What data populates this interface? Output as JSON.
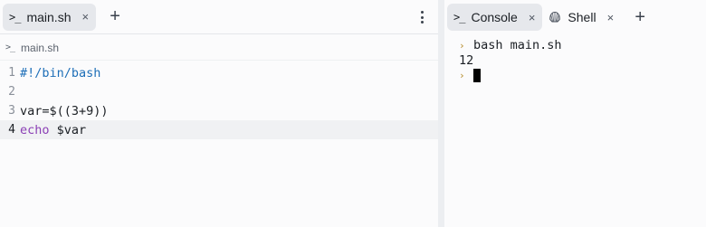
{
  "editor_pane": {
    "tab": {
      "icon": "terminal-prompt-icon",
      "label": "main.sh",
      "close": "×"
    },
    "new_tab": "+",
    "menu_icon": "kebab-menu-icon",
    "breadcrumb": {
      "icon": "terminal-prompt-icon",
      "label": "main.sh"
    },
    "lines": [
      {
        "number": "1",
        "text": "#!/bin/bash"
      },
      {
        "number": "2",
        "text": ""
      },
      {
        "number": "3",
        "text": "var=$((3+9))"
      },
      {
        "number": "4",
        "keyword": "echo",
        "text": " $var"
      }
    ]
  },
  "console_pane": {
    "tabs": [
      {
        "icon": "terminal-prompt-icon",
        "label": "Console",
        "close": "×",
        "active": true
      },
      {
        "icon": "shell-icon",
        "label": "Shell",
        "close": "×",
        "active": false
      }
    ],
    "new_tab": "+",
    "output": {
      "command": "bash main.sh",
      "result": "12"
    }
  },
  "colors": {
    "accent_caret": "#b58b2a",
    "comment": "#1e6fb8",
    "keyword": "#8b3fb5"
  }
}
